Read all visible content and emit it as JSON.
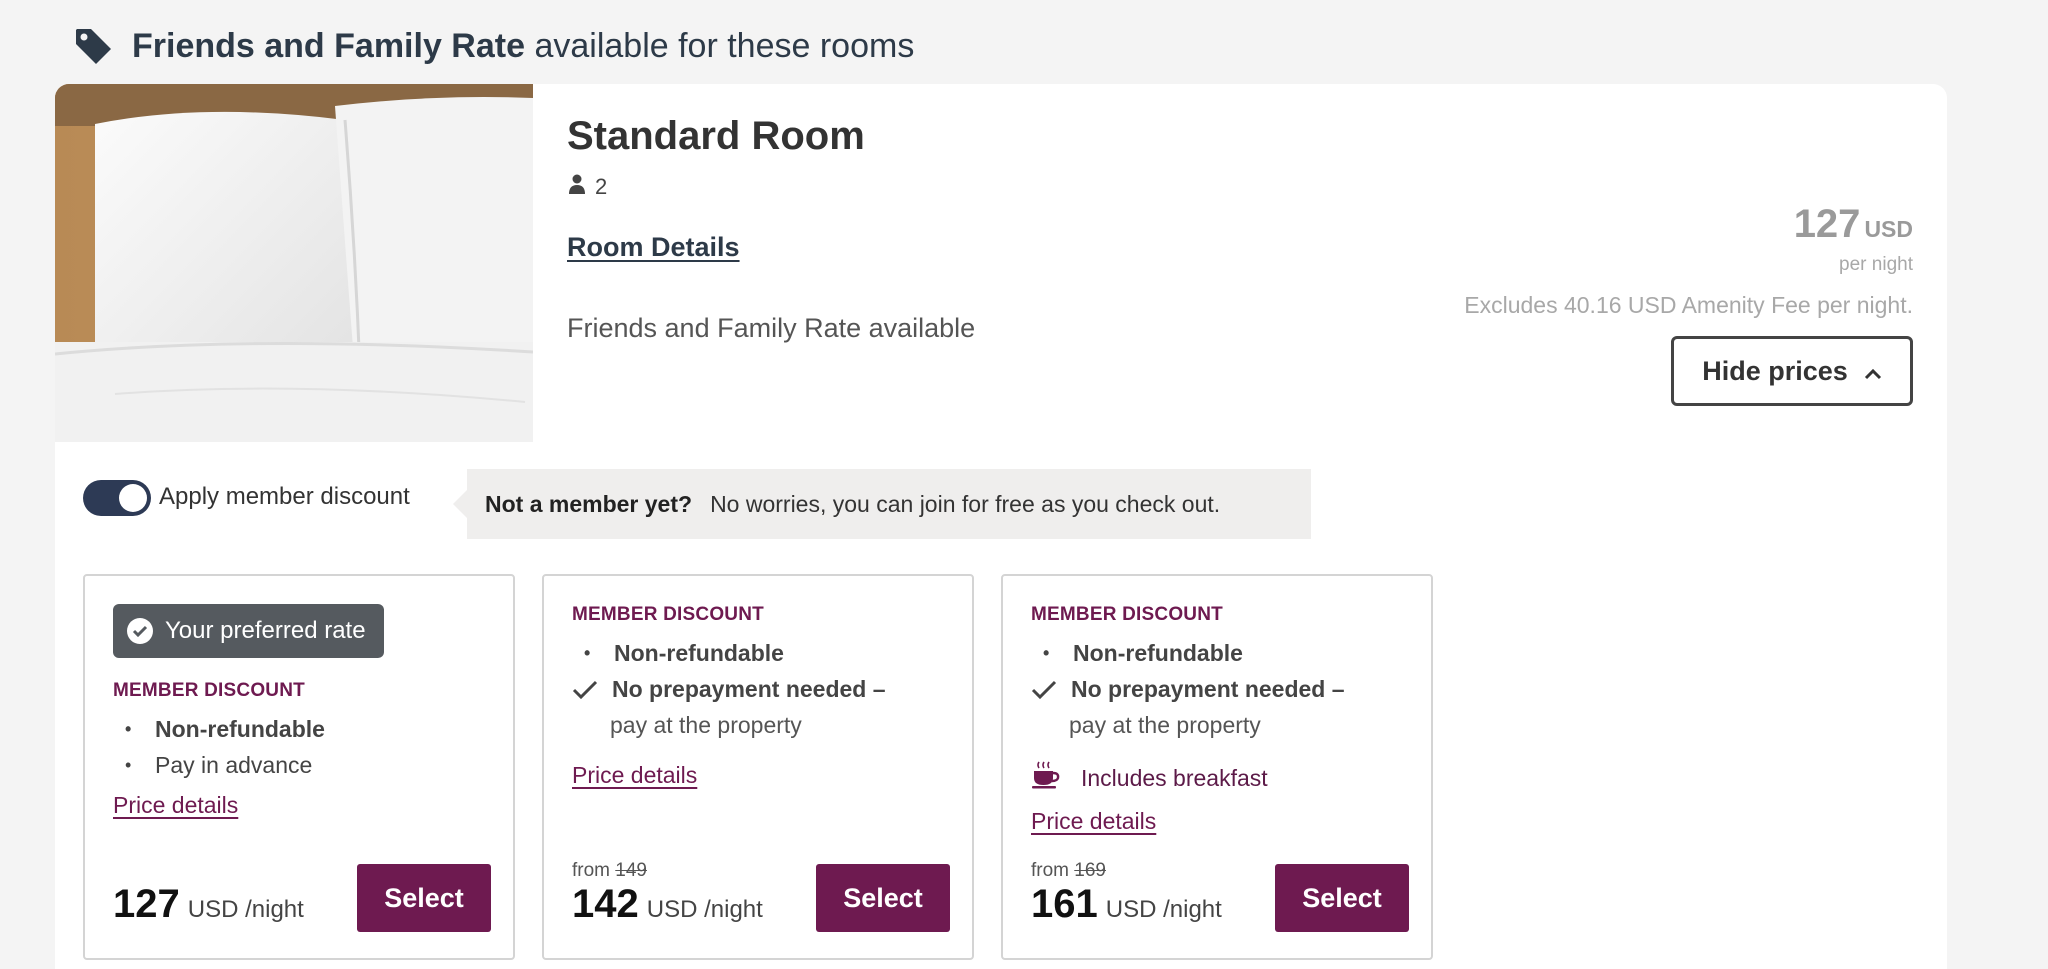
{
  "banner": {
    "bold": "Friends and Family Rate",
    "rest": "available for these rooms"
  },
  "room": {
    "title": "Standard Room",
    "occupancy": "2",
    "details_link": "Room Details",
    "note": "Friends and Family Rate available",
    "price": "127",
    "currency": "USD",
    "per_night": "per night",
    "excludes": "Excludes 40.16 USD Amenity Fee per night.",
    "hide_prices": "Hide prices"
  },
  "member": {
    "toggle_label": "Apply member discount",
    "toggle_on": true,
    "note_bold": "Not a member yet?",
    "note_text": "No worries, you can join for free as you check out."
  },
  "rates": [
    {
      "badge": "Your preferred rate",
      "label": "MEMBER DISCOUNT",
      "line1": "Non-refundable",
      "line2": "Pay in advance",
      "price_link": "Price details",
      "price": "127",
      "unit": "USD /night",
      "select": "Select"
    },
    {
      "label": "MEMBER DISCOUNT",
      "line1": "Non-refundable",
      "line2": "No prepayment needed –",
      "line3": "pay at the property",
      "price_link": "Price details",
      "from": "from",
      "old_price": "149",
      "price": "142",
      "unit": "USD /night",
      "select": "Select"
    },
    {
      "label": "MEMBER DISCOUNT",
      "line1": "Non-refundable",
      "line2": "No prepayment needed –",
      "line3": "pay at the property",
      "extra": "Includes breakfast",
      "price_link": "Price details",
      "from": "from",
      "old_price": "169",
      "price": "161",
      "unit": "USD /night",
      "select": "Select"
    }
  ],
  "colors": {
    "brand": "#6e1a50",
    "navy": "#2d3a48",
    "toggle": "#2d3a55"
  },
  "icons": {
    "banner": "tag-icon",
    "occupancy": "person-icon",
    "hide": "chevron-up-icon",
    "badge": "check-circle-icon",
    "included": "checkmark-icon",
    "breakfast": "coffee-cup-icon"
  }
}
